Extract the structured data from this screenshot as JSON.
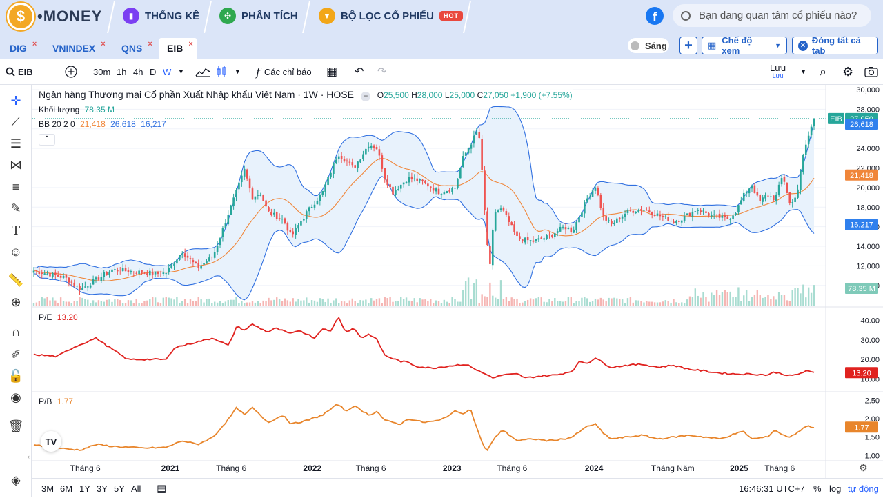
{
  "topbar": {
    "logo_text": "•MONEY",
    "logo_symbol": "$",
    "nav": [
      {
        "label": "THỐNG KÊ",
        "icon": "stats-icon",
        "color": "#7b3ff2"
      },
      {
        "label": "PHÂN TÍCH",
        "icon": "analysis-icon",
        "color": "#2fa84f"
      },
      {
        "label": "BỘ LỌC CỔ PHIẾU",
        "icon": "filter-icon",
        "color": "#f2a618"
      }
    ],
    "hot_badge": "HOT",
    "search_placeholder": "Bạn đang quan tâm cổ phiếu nào?"
  },
  "tabs": [
    {
      "label": "DIG",
      "close": "×"
    },
    {
      "label": "VNINDEX",
      "close": "×"
    },
    {
      "label": "QNS",
      "close": "×"
    },
    {
      "label": "EIB",
      "close": "×",
      "active": true
    }
  ],
  "tabbar_right": {
    "theme_label": "Sáng",
    "add": "+",
    "view_mode": "Chế độ xem",
    "close_all": "Đóng tất cả tab"
  },
  "toolbar": {
    "symbol": "EIB",
    "intervals": [
      "30m",
      "1h",
      "4h",
      "D",
      "W"
    ],
    "active_interval": "W",
    "indicators_label": "Các chỉ báo",
    "save_label": "Lưu",
    "save_sub": "Lưu"
  },
  "bottombar": {
    "ranges": [
      "3M",
      "6M",
      "1Y",
      "3Y",
      "5Y",
      "All"
    ],
    "time": "16:46:31 UTC+7",
    "percent": "%",
    "log": "log",
    "auto": "tự động"
  },
  "chart_header": {
    "title": "Ngân hàng Thương mại Cổ phần Xuất Nhập khẩu Việt Nam · 1W · HOSE",
    "o_label": "O",
    "o": "25,500",
    "h_label": "H",
    "h": "28,000",
    "l_label": "L",
    "l": "25,000",
    "c_label": "C",
    "c": "27,050",
    "change": "+1,900 (+7.55%)",
    "volume_label": "Khối lượng",
    "volume": "78.35 M",
    "bb_label": "BB 20 2 0",
    "bb_mid": "21,418",
    "bb_upper": "26,618",
    "bb_lower": "16,217",
    "pe_label": "P/E",
    "pe": "13.20",
    "pb_label": "P/B",
    "pb": "1.77"
  },
  "axes": {
    "price_ticks": [
      "30,000",
      "28,000",
      "24,000",
      "22,000",
      "20,000",
      "18,000",
      "16,000",
      "14,000",
      "12,000",
      "10,000"
    ],
    "pe_ticks": [
      "40.00",
      "30.00",
      "20.00",
      "10.00"
    ],
    "pb_ticks": [
      "2.50",
      "2.00",
      "1.50",
      "1.00"
    ],
    "time_labels": [
      "Tháng 6",
      "2021",
      "Tháng 6",
      "2022",
      "Tháng 6",
      "2023",
      "Tháng 6",
      "2024",
      "Tháng Năm",
      "2025",
      "Tháng 6"
    ]
  },
  "price_labels": {
    "symbol": "EIB",
    "last": "27,050",
    "bb_upper": "26,618",
    "bb_mid": "21,418",
    "bb_lower": "16,217",
    "volume": "78.35 M",
    "pe": "13.20",
    "pb": "1.77"
  },
  "chart_data": {
    "type": "candlestick",
    "symbol": "EIB",
    "interval": "1W",
    "price_range": [
      9000,
      30000
    ],
    "price_anchors": [
      {
        "t": 0.0,
        "p": 11500
      },
      {
        "t": 0.04,
        "p": 10800
      },
      {
        "t": 0.06,
        "p": 9600
      },
      {
        "t": 0.1,
        "p": 11600
      },
      {
        "t": 0.16,
        "p": 11200
      },
      {
        "t": 0.17,
        "p": 11300
      },
      {
        "t": 0.19,
        "p": 13500
      },
      {
        "t": 0.21,
        "p": 11800
      },
      {
        "t": 0.23,
        "p": 13000
      },
      {
        "t": 0.25,
        "p": 17500
      },
      {
        "t": 0.27,
        "p": 21800
      },
      {
        "t": 0.28,
        "p": 19000
      },
      {
        "t": 0.29,
        "p": 19500
      },
      {
        "t": 0.3,
        "p": 17500
      },
      {
        "t": 0.32,
        "p": 16700
      },
      {
        "t": 0.33,
        "p": 15000
      },
      {
        "t": 0.35,
        "p": 17500
      },
      {
        "t": 0.37,
        "p": 19500
      },
      {
        "t": 0.39,
        "p": 23500
      },
      {
        "t": 0.41,
        "p": 22000
      },
      {
        "t": 0.43,
        "p": 24500
      },
      {
        "t": 0.44,
        "p": 24000
      },
      {
        "t": 0.45,
        "p": 21000
      },
      {
        "t": 0.46,
        "p": 19500
      },
      {
        "t": 0.48,
        "p": 21000
      },
      {
        "t": 0.5,
        "p": 20500
      },
      {
        "t": 0.52,
        "p": 19500
      },
      {
        "t": 0.54,
        "p": 20000
      },
      {
        "t": 0.55,
        "p": 23000
      },
      {
        "t": 0.56,
        "p": 24500
      },
      {
        "t": 0.57,
        "p": 26000
      },
      {
        "t": 0.575,
        "p": 21000
      },
      {
        "t": 0.58,
        "p": 15000
      },
      {
        "t": 0.585,
        "p": 11800
      },
      {
        "t": 0.59,
        "p": 17500
      },
      {
        "t": 0.6,
        "p": 17800
      },
      {
        "t": 0.62,
        "p": 14800
      },
      {
        "t": 0.64,
        "p": 14500
      },
      {
        "t": 0.66,
        "p": 15000
      },
      {
        "t": 0.68,
        "p": 16000
      },
      {
        "t": 0.69,
        "p": 15500
      },
      {
        "t": 0.71,
        "p": 19000
      },
      {
        "t": 0.72,
        "p": 20200
      },
      {
        "t": 0.73,
        "p": 17000
      },
      {
        "t": 0.74,
        "p": 16200
      },
      {
        "t": 0.76,
        "p": 17500
      },
      {
        "t": 0.78,
        "p": 17800
      },
      {
        "t": 0.8,
        "p": 17200
      },
      {
        "t": 0.82,
        "p": 16500
      },
      {
        "t": 0.83,
        "p": 16800
      },
      {
        "t": 0.85,
        "p": 17800
      },
      {
        "t": 0.87,
        "p": 17100
      },
      {
        "t": 0.89,
        "p": 16800
      },
      {
        "t": 0.9,
        "p": 17600
      },
      {
        "t": 0.91,
        "p": 19200
      },
      {
        "t": 0.92,
        "p": 20300
      },
      {
        "t": 0.93,
        "p": 18500
      },
      {
        "t": 0.94,
        "p": 19300
      },
      {
        "t": 0.95,
        "p": 18800
      },
      {
        "t": 0.96,
        "p": 21300
      },
      {
        "t": 0.97,
        "p": 18000
      },
      {
        "t": 0.98,
        "p": 20000
      },
      {
        "t": 0.985,
        "p": 22800
      },
      {
        "t": 0.99,
        "p": 24500
      },
      {
        "t": 1.0,
        "p": 27050
      }
    ],
    "pe_range": [
      8,
      43
    ],
    "pe_anchors": [
      {
        "t": 0.0,
        "v": 22.5
      },
      {
        "t": 0.03,
        "v": 21.5
      },
      {
        "t": 0.05,
        "v": 26
      },
      {
        "t": 0.08,
        "v": 31
      },
      {
        "t": 0.09,
        "v": 28
      },
      {
        "t": 0.12,
        "v": 20
      },
      {
        "t": 0.17,
        "v": 20
      },
      {
        "t": 0.18,
        "v": 26
      },
      {
        "t": 0.21,
        "v": 29
      },
      {
        "t": 0.23,
        "v": 31
      },
      {
        "t": 0.25,
        "v": 27
      },
      {
        "t": 0.26,
        "v": 37
      },
      {
        "t": 0.27,
        "v": 35
      },
      {
        "t": 0.28,
        "v": 38
      },
      {
        "t": 0.3,
        "v": 34
      },
      {
        "t": 0.31,
        "v": 36
      },
      {
        "t": 0.33,
        "v": 33
      },
      {
        "t": 0.34,
        "v": 35
      },
      {
        "t": 0.36,
        "v": 31
      },
      {
        "t": 0.37,
        "v": 36
      },
      {
        "t": 0.38,
        "v": 34
      },
      {
        "t": 0.39,
        "v": 42
      },
      {
        "t": 0.4,
        "v": 34
      },
      {
        "t": 0.41,
        "v": 36
      },
      {
        "t": 0.42,
        "v": 31
      },
      {
        "t": 0.43,
        "v": 33
      },
      {
        "t": 0.44,
        "v": 30
      },
      {
        "t": 0.45,
        "v": 22
      },
      {
        "t": 0.47,
        "v": 19
      },
      {
        "t": 0.48,
        "v": 18.5
      },
      {
        "t": 0.49,
        "v": 16.5
      },
      {
        "t": 0.5,
        "v": 16
      },
      {
        "t": 0.51,
        "v": 15.5
      },
      {
        "t": 0.53,
        "v": 16.5
      },
      {
        "t": 0.55,
        "v": 17.5
      },
      {
        "t": 0.56,
        "v": 16.5
      },
      {
        "t": 0.57,
        "v": 14
      },
      {
        "t": 0.59,
        "v": 10.5
      },
      {
        "t": 0.6,
        "v": 12
      },
      {
        "t": 0.62,
        "v": 12.5
      },
      {
        "t": 0.63,
        "v": 10.5
      },
      {
        "t": 0.65,
        "v": 11.5
      },
      {
        "t": 0.67,
        "v": 12
      },
      {
        "t": 0.69,
        "v": 14
      },
      {
        "t": 0.7,
        "v": 19
      },
      {
        "t": 0.71,
        "v": 18
      },
      {
        "t": 0.72,
        "v": 21
      },
      {
        "t": 0.73,
        "v": 18
      },
      {
        "t": 0.74,
        "v": 16
      },
      {
        "t": 0.76,
        "v": 17
      },
      {
        "t": 0.78,
        "v": 17.5
      },
      {
        "t": 0.8,
        "v": 16
      },
      {
        "t": 0.82,
        "v": 17
      },
      {
        "t": 0.84,
        "v": 15
      },
      {
        "t": 0.86,
        "v": 14
      },
      {
        "t": 0.88,
        "v": 13
      },
      {
        "t": 0.9,
        "v": 12.5
      },
      {
        "t": 0.92,
        "v": 12.5
      },
      {
        "t": 0.94,
        "v": 12
      },
      {
        "t": 0.95,
        "v": 13.5
      },
      {
        "t": 0.97,
        "v": 11.5
      },
      {
        "t": 0.98,
        "v": 12.5
      },
      {
        "t": 0.99,
        "v": 14
      },
      {
        "t": 1.0,
        "v": 13.2
      }
    ],
    "pb_range": [
      0.95,
      2.6
    ],
    "pb_anchors": [
      {
        "t": 0.0,
        "v": 1.3
      },
      {
        "t": 0.04,
        "v": 1.18
      },
      {
        "t": 0.06,
        "v": 1.15
      },
      {
        "t": 0.08,
        "v": 1.3
      },
      {
        "t": 0.1,
        "v": 1.25
      },
      {
        "t": 0.14,
        "v": 1.2
      },
      {
        "t": 0.17,
        "v": 1.22
      },
      {
        "t": 0.19,
        "v": 1.4
      },
      {
        "t": 0.21,
        "v": 1.3
      },
      {
        "t": 0.23,
        "v": 1.5
      },
      {
        "t": 0.25,
        "v": 2.0
      },
      {
        "t": 0.26,
        "v": 2.3
      },
      {
        "t": 0.27,
        "v": 2.1
      },
      {
        "t": 0.28,
        "v": 2.3
      },
      {
        "t": 0.3,
        "v": 1.9
      },
      {
        "t": 0.32,
        "v": 2.1
      },
      {
        "t": 0.33,
        "v": 1.85
      },
      {
        "t": 0.35,
        "v": 1.95
      },
      {
        "t": 0.37,
        "v": 2.1
      },
      {
        "t": 0.39,
        "v": 2.4
      },
      {
        "t": 0.4,
        "v": 2.2
      },
      {
        "t": 0.41,
        "v": 2.35
      },
      {
        "t": 0.43,
        "v": 2.1
      },
      {
        "t": 0.44,
        "v": 2.2
      },
      {
        "t": 0.45,
        "v": 1.95
      },
      {
        "t": 0.47,
        "v": 1.85
      },
      {
        "t": 0.48,
        "v": 2.0
      },
      {
        "t": 0.5,
        "v": 1.9
      },
      {
        "t": 0.52,
        "v": 1.95
      },
      {
        "t": 0.54,
        "v": 2.2
      },
      {
        "t": 0.55,
        "v": 2.15
      },
      {
        "t": 0.56,
        "v": 2.25
      },
      {
        "t": 0.57,
        "v": 1.6
      },
      {
        "t": 0.58,
        "v": 1.1
      },
      {
        "t": 0.59,
        "v": 1.45
      },
      {
        "t": 0.6,
        "v": 1.7
      },
      {
        "t": 0.62,
        "v": 1.4
      },
      {
        "t": 0.64,
        "v": 1.45
      },
      {
        "t": 0.66,
        "v": 1.4
      },
      {
        "t": 0.68,
        "v": 1.45
      },
      {
        "t": 0.69,
        "v": 1.5
      },
      {
        "t": 0.71,
        "v": 1.8
      },
      {
        "t": 0.72,
        "v": 1.85
      },
      {
        "t": 0.73,
        "v": 1.6
      },
      {
        "t": 0.74,
        "v": 1.45
      },
      {
        "t": 0.76,
        "v": 1.5
      },
      {
        "t": 0.78,
        "v": 1.55
      },
      {
        "t": 0.8,
        "v": 1.45
      },
      {
        "t": 0.82,
        "v": 1.5
      },
      {
        "t": 0.84,
        "v": 1.55
      },
      {
        "t": 0.86,
        "v": 1.5
      },
      {
        "t": 0.88,
        "v": 1.45
      },
      {
        "t": 0.9,
        "v": 1.6
      },
      {
        "t": 0.91,
        "v": 1.65
      },
      {
        "t": 0.92,
        "v": 1.45
      },
      {
        "t": 0.94,
        "v": 1.5
      },
      {
        "t": 0.95,
        "v": 1.7
      },
      {
        "t": 0.96,
        "v": 1.55
      },
      {
        "t": 0.97,
        "v": 1.5
      },
      {
        "t": 0.98,
        "v": 1.65
      },
      {
        "t": 0.99,
        "v": 1.8
      },
      {
        "t": 1.0,
        "v": 1.77
      }
    ],
    "bb_upper_last": 26618,
    "bb_mid_last": 21418,
    "bb_lower_last": 16217,
    "colors": {
      "up": "#26a69a",
      "down": "#ef5350",
      "bb_band": "#2f6fe0",
      "bb_mid": "#f0863a",
      "bb_fill": "#e8f2fc",
      "pe_line": "#e0221f",
      "pb_line": "#e8852b"
    }
  }
}
